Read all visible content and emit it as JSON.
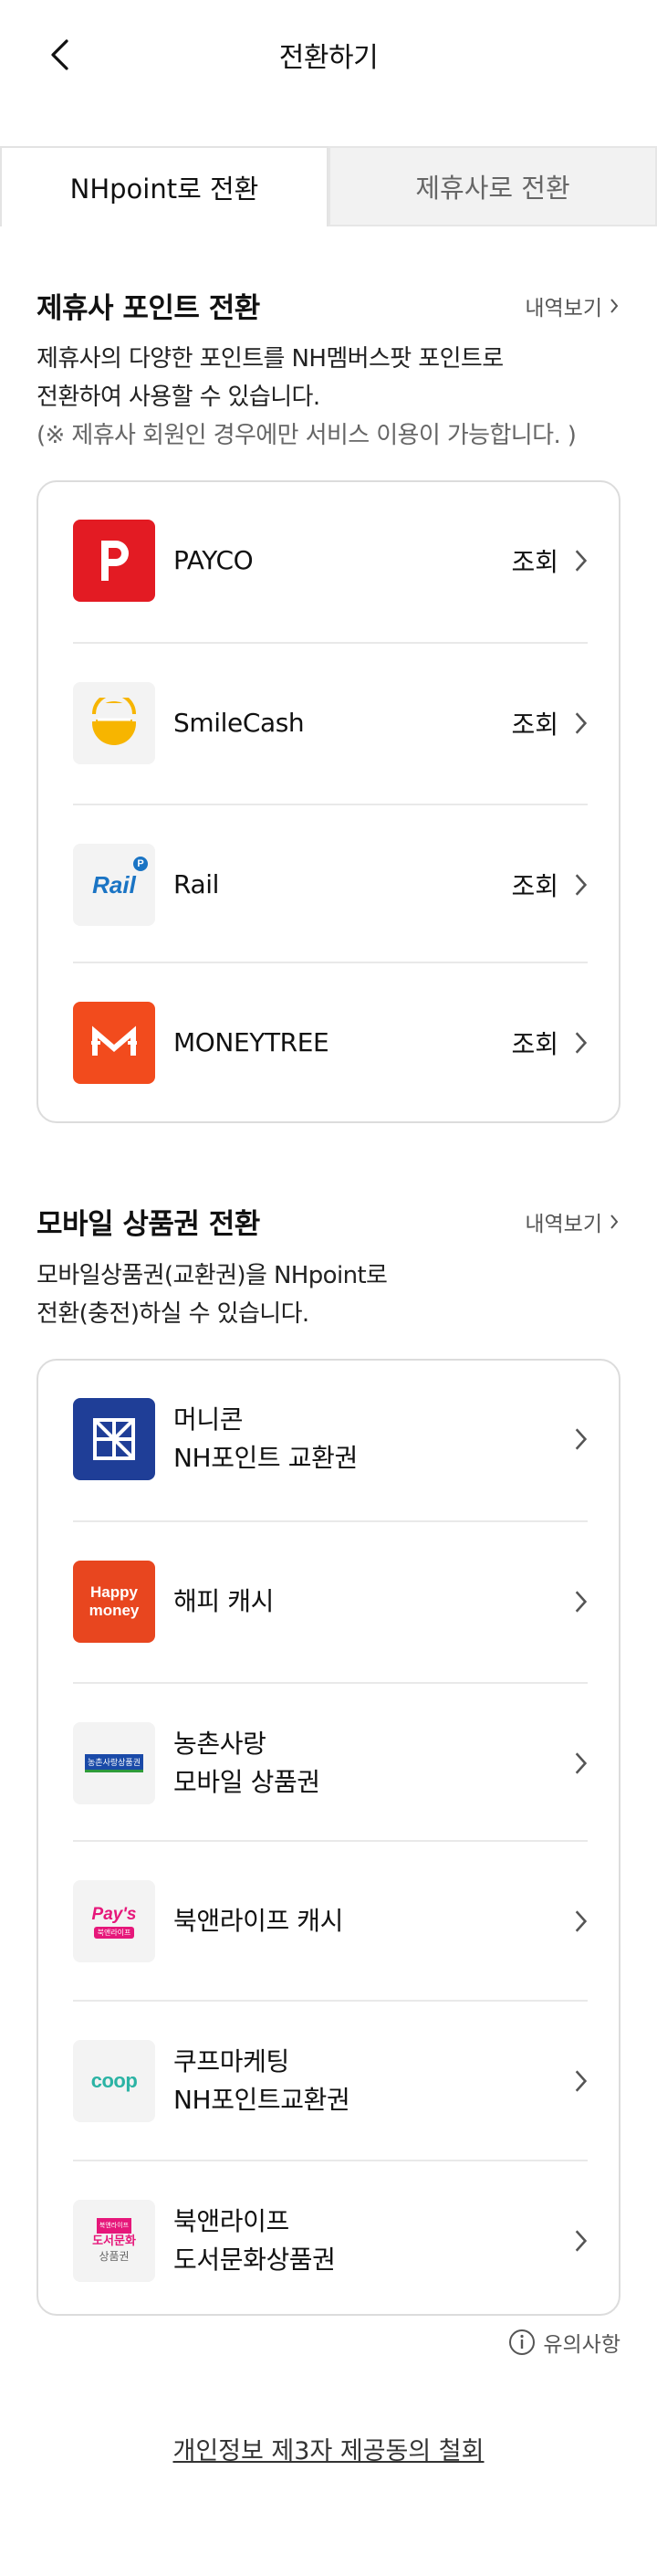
{
  "header": {
    "title": "전환하기"
  },
  "tabs": [
    {
      "label": "NHpoint로 전환",
      "active": true
    },
    {
      "label": "제휴사로 전환",
      "active": false
    }
  ],
  "partner": {
    "title": "제휴사 포인트 전환",
    "history_label": "내역보기",
    "desc_line1": "제휴사의 다양한 포인트를 NH멤버스팟 포인트로",
    "desc_line2": "전환하여 사용할 수 있습니다.",
    "desc_note": "(※ 제휴사 회원인 경우에만 서비스 이용이 가능합니다. )",
    "items": [
      {
        "name": "PAYCO",
        "action": "조회",
        "icon": "payco-logo"
      },
      {
        "name": "SmileCash",
        "action": "조회",
        "icon": "smilecash-logo"
      },
      {
        "name": "Rail",
        "action": "조회",
        "icon": "rail-logo"
      },
      {
        "name": "MONEYTREE",
        "action": "조회",
        "icon": "moneytree-logo"
      }
    ]
  },
  "mobile": {
    "title": "모바일 상품권 전환",
    "history_label": "내역보기",
    "desc_line1": "모바일상품권(교환권)을 NHpoint로",
    "desc_line2": "전환(충전)하실 수 있습니다.",
    "items": [
      {
        "line1": "머니콘",
        "line2": "NH포인트 교환권",
        "icon": "moneycon-logo"
      },
      {
        "line1": "해피 캐시",
        "line2": "",
        "icon": "happymoney-logo"
      },
      {
        "line1": "농촌사랑",
        "line2": "모바일 상품권",
        "icon": "nongchon-logo"
      },
      {
        "line1": "북앤라이프 캐시",
        "line2": "",
        "icon": "pays-logo"
      },
      {
        "line1": "쿠프마케팅",
        "line2": "NH포인트교환권",
        "icon": "coop-logo"
      },
      {
        "line1": "북앤라이프",
        "line2": "도서문화상품권",
        "icon": "book-culture-logo"
      }
    ]
  },
  "logos": {
    "rail_text": "Rail",
    "rail_badge": "P",
    "happy_line1": "Happy",
    "happy_line2": "money",
    "nongchon_text": "농촌사랑상품권",
    "pays_text": "Pay's",
    "pays_sub": "북앤라이프",
    "coop_text": "coop",
    "book_top": "북앤라이프",
    "book_mid": "도서문화",
    "book_bottom": "상품권"
  },
  "notice": {
    "label": "유의사항"
  },
  "footer": {
    "link": "개인정보 제3자 제공동의 철회"
  },
  "colors": {
    "payco": "#e31b23",
    "moneytree": "#f24b1d",
    "moneycon": "#1f3e97",
    "happymoney": "#e8461f",
    "rail": "#1a74c4"
  }
}
